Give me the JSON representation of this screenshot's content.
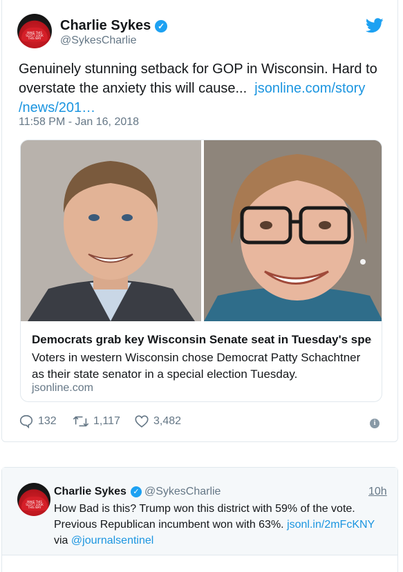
{
  "main_tweet": {
    "author_name": "Charlie Sykes",
    "handle": "@SykesCharlie",
    "avatar_hat_text": "MAKE THIS SCOTT LOOK THIS WAY",
    "text": "Genuinely stunning setback for GOP in Wisconsin. Hard to overstate the anxiety this will cause...",
    "link_line1": "jsonline.com/story",
    "link_line2": "/news/201…",
    "timestamp": "11:58 PM - Jan 16, 2018",
    "card": {
      "title": "Democrats grab key Wisconsin Senate seat in Tuesday's spec…",
      "description": "Voters in western Wisconsin chose Democrat Patty Schachtner as their state senator in a special election Tuesday.",
      "domain": "jsonline.com"
    },
    "actions": {
      "replies": "132",
      "retweets": "1,117",
      "likes": "3,482"
    }
  },
  "reply_tweet": {
    "author_name": "Charlie Sykes",
    "handle": "@SykesCharlie",
    "time": "10h",
    "text_part1": "How Bad is this? Trump won this district with 59% of the vote. Previous Republican incumbent won with 63%.",
    "link": "jsonl.in/2mFcKNY",
    "via": "via",
    "mention": "@journalsentinel"
  },
  "colors": {
    "accent": "#1da1f2",
    "link": "#1b95e0",
    "muted": "#657786",
    "border": "#e1e8ed"
  },
  "icons": [
    "verified-badge-icon",
    "twitter-bird-icon",
    "reply-icon",
    "retweet-icon",
    "like-icon",
    "info-icon"
  ]
}
